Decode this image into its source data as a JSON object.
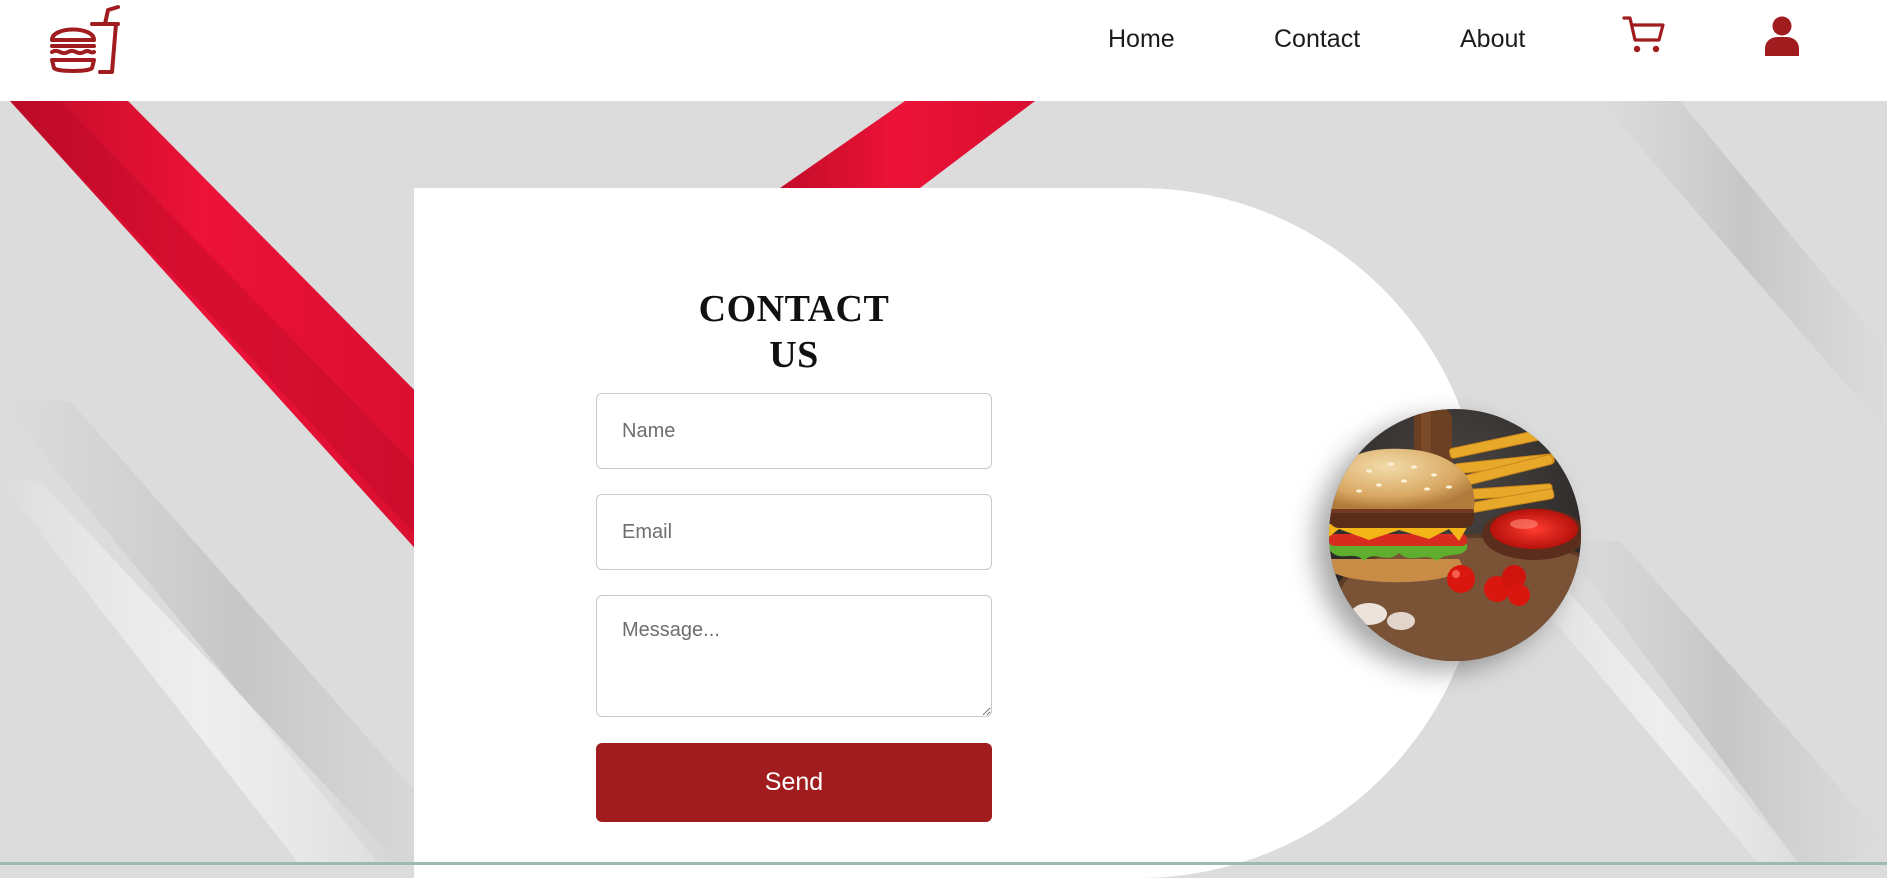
{
  "header": {
    "logo_name": "burger-and-drink-logo",
    "nav": {
      "home": "Home",
      "contact": "Contact",
      "about": "About"
    },
    "cart_icon": "cart-icon",
    "user_icon": "user-icon"
  },
  "contact": {
    "title": "CONTACT US",
    "name_placeholder": "Name",
    "email_placeholder": "Email",
    "message_placeholder": "Message...",
    "send_label": "Send"
  },
  "colors": {
    "brand_red": "#a01c1e",
    "ribbon_red": "#e61136",
    "background_gray": "#dcdcdc",
    "card_white": "#ffffff"
  }
}
